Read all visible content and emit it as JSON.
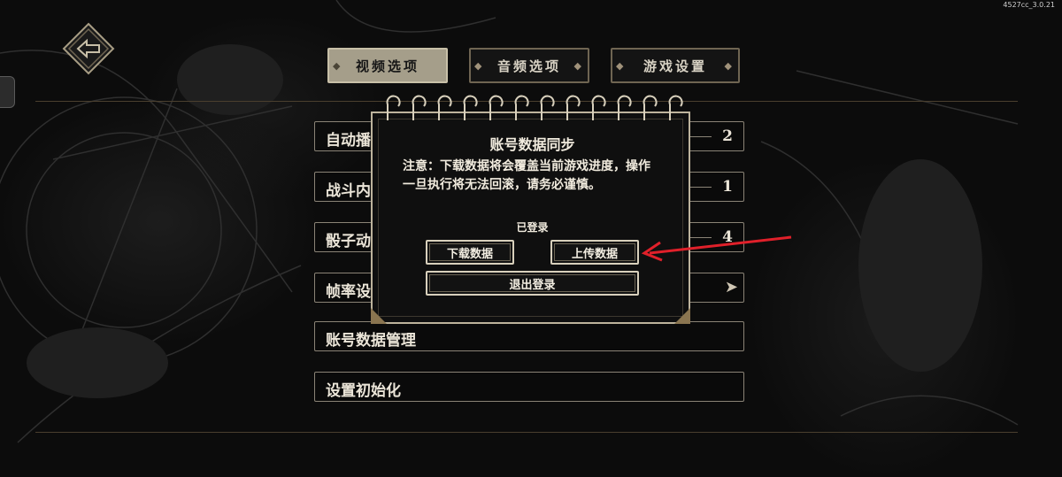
{
  "version": "4527cc_3.0.21",
  "back_button": {
    "icon": "back-arrow-icon"
  },
  "tabs": [
    {
      "label": "视频选项",
      "active": true
    },
    {
      "label": "音频选项",
      "active": false
    },
    {
      "label": "游戏设置",
      "active": false
    }
  ],
  "settings": {
    "rows": [
      {
        "label": "自动播",
        "value": "2"
      },
      {
        "label": "战斗内",
        "value": "1"
      },
      {
        "label": "骰子动",
        "value": "4"
      },
      {
        "label": "帧率设",
        "value": ""
      },
      {
        "label": "账号数据管理",
        "value": ""
      },
      {
        "label": "设置初始化",
        "value": ""
      }
    ]
  },
  "dialog": {
    "title": "账号数据同步",
    "warning": "注意：下载数据将会覆盖当前游戏进度，操作一旦执行将无法回滚，请务必谨慎。",
    "status": "已登录",
    "download_label": "下载数据",
    "upload_label": "上传数据",
    "logout_label": "退出登录"
  },
  "colors": {
    "accent_gold": "#bdb39c",
    "annotation_red": "#e0202a",
    "active_tab": "#a59e8a"
  }
}
